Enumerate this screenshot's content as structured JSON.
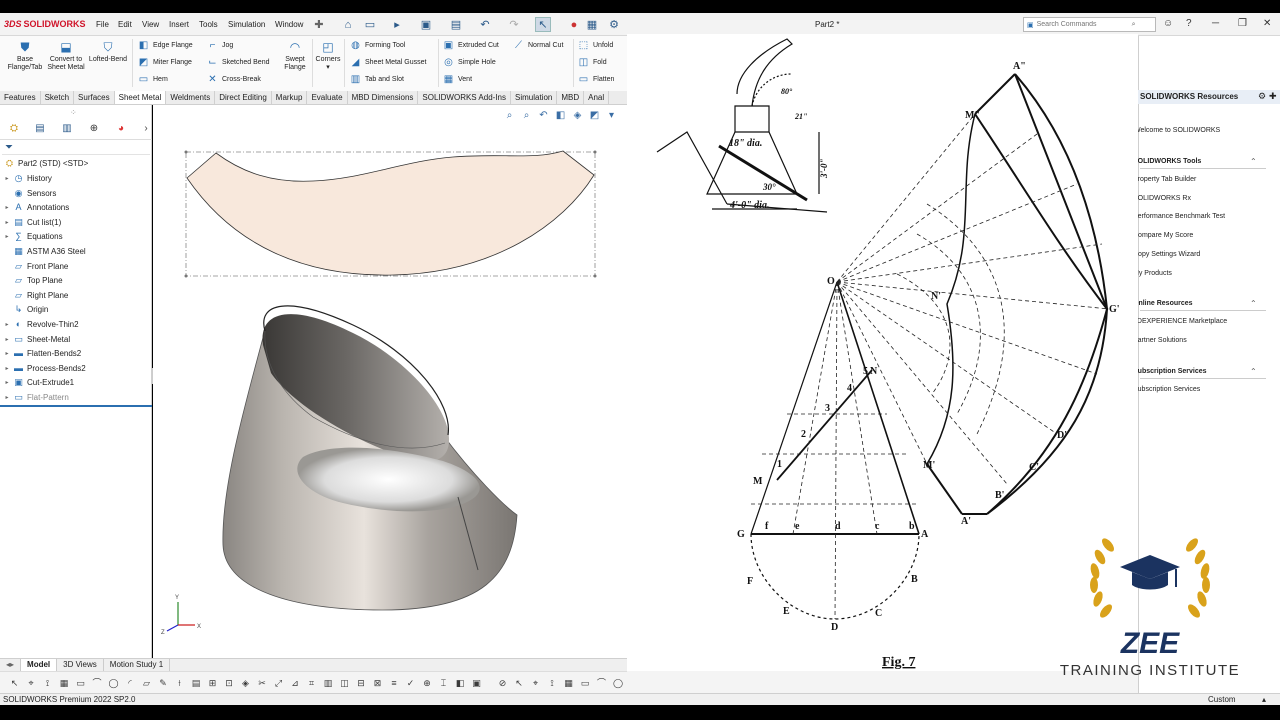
{
  "app": {
    "logo_prefix": "3DS",
    "logo_text": "SOLIDWORKS",
    "document_title": "Part2 *"
  },
  "menus": [
    "File",
    "Edit",
    "View",
    "Insert",
    "Tools",
    "Simulation",
    "Window"
  ],
  "search": {
    "placeholder": "Search Commands"
  },
  "command_manager": {
    "large_buttons": [
      "Base Flange/Tab",
      "Convert to Sheet Metal",
      "Lofted-Bend"
    ],
    "col1": [
      "Edge Flange",
      "Miter Flange",
      "Hem"
    ],
    "col2": [
      "Jog",
      "Sketched Bend",
      "Cross-Break"
    ],
    "swept": "Swept Flange",
    "corners": "Corners",
    "col3": [
      "Forming Tool",
      "Sheet Metal Gusset",
      "Tab and Slot"
    ],
    "col4": [
      "Extruded Cut",
      "Simple Hole",
      "Vent"
    ],
    "normal_cut": "Normal Cut",
    "col5": [
      "Unfold",
      "Fold",
      "Flatten"
    ]
  },
  "tabs": [
    "Features",
    "Sketch",
    "Surfaces",
    "Sheet Metal",
    "Weldments",
    "Direct Editing",
    "Markup",
    "Evaluate",
    "MBD Dimensions",
    "SOLIDWORKS Add-Ins",
    "Simulation",
    "MBD",
    "Anal"
  ],
  "active_tab": "Sheet Metal",
  "feature_tree": {
    "root": "Part2 (STD) <STD>",
    "items": [
      {
        "label": "History",
        "icon": "history-icon",
        "expand": true
      },
      {
        "label": "Sensors",
        "icon": "sensor-icon",
        "expand": false
      },
      {
        "label": "Annotations",
        "icon": "annotation-icon",
        "expand": true
      },
      {
        "label": "Cut list(1)",
        "icon": "cutlist-icon",
        "expand": true
      },
      {
        "label": "Equations",
        "icon": "equation-icon",
        "expand": true
      },
      {
        "label": "ASTM A36 Steel",
        "icon": "material-icon",
        "expand": false
      },
      {
        "label": "Front Plane",
        "icon": "plane-icon",
        "expand": false
      },
      {
        "label": "Top Plane",
        "icon": "plane-icon",
        "expand": false
      },
      {
        "label": "Right Plane",
        "icon": "plane-icon",
        "expand": false
      },
      {
        "label": "Origin",
        "icon": "origin-icon",
        "expand": false
      },
      {
        "label": "Revolve-Thin2",
        "icon": "revolve-icon",
        "expand": true
      },
      {
        "label": "Sheet-Metal",
        "icon": "sheetmetal-icon",
        "expand": true
      },
      {
        "label": "Flatten-Bends2",
        "icon": "flatten-icon",
        "expand": true
      },
      {
        "label": "Process-Bends2",
        "icon": "process-icon",
        "expand": true
      },
      {
        "label": "Cut-Extrude1",
        "icon": "cut-icon",
        "expand": true
      },
      {
        "label": "Flat-Pattern",
        "icon": "flatpattern-icon",
        "expand": true,
        "dim": true
      }
    ]
  },
  "bottom_tabs": [
    "Model",
    "3D Views",
    "Motion Study 1"
  ],
  "status": {
    "left": "SOLIDWORKS Premium 2022 SP2.0",
    "right": "Custom"
  },
  "task_pane": {
    "title": "SOLIDWORKS Resources",
    "welcome": "Welcome to SOLIDWORKS",
    "sections": [
      {
        "title": "SOLIDWORKS Tools",
        "items": [
          "Property Tab Builder",
          "SOLIDWORKS Rx",
          "Performance Benchmark Test",
          "Compare My Score",
          "Copy Settings Wizard",
          "My Products"
        ]
      },
      {
        "title": "Online Resources",
        "items": [
          "3DEXPERIENCE Marketplace",
          "Partner Solutions"
        ]
      },
      {
        "title": "Subscription Services",
        "items": [
          "Subscription Services"
        ]
      }
    ]
  },
  "drawing": {
    "top_labels": [
      "80°",
      "18\" dia.",
      "3'-0\"",
      "30°",
      "4'-0\" dia.",
      "21\""
    ],
    "point_labels": [
      "A\"",
      "M\"",
      "O",
      "G'",
      "D'",
      "C'",
      "B'",
      "A'",
      "M'",
      "N",
      "M",
      "G",
      "f",
      "e",
      "d",
      "c",
      "b",
      "A",
      "F",
      "B",
      "E",
      "C",
      "D",
      "1",
      "2",
      "3",
      "4",
      "5",
      "N'",
      "Fig. 7"
    ]
  },
  "brand": {
    "name": "ZEE",
    "subtitle": "TRAINING INSTITUTE",
    "gold": "#d9a21b",
    "navy": "#1b3360"
  },
  "colors": {
    "accent": "#2b6fb0",
    "flat_pattern_fill": "#f8e8dc"
  }
}
